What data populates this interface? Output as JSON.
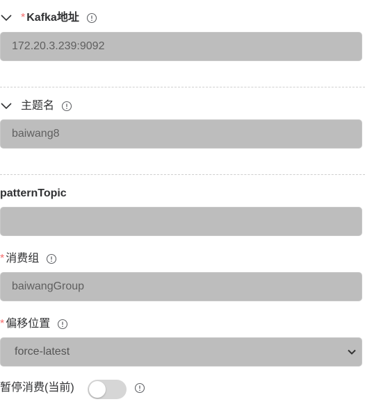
{
  "kafka_address": {
    "required_mark": "*",
    "label": "Kafka地址",
    "value": "172.20.3.239:9092",
    "collapse_icon": "chevron-down-icon",
    "info_icon": "info-circle-icon"
  },
  "topic_name": {
    "label": "主题名",
    "value": "baiwang8",
    "collapse_icon": "chevron-down-icon",
    "info_icon": "info-circle-icon"
  },
  "pattern_topic": {
    "label": "patternTopic",
    "value": ""
  },
  "consumer_group": {
    "required_mark": "*",
    "label": "消费组",
    "value": "baiwangGroup",
    "info_icon": "info-circle-icon"
  },
  "offset_position": {
    "required_mark": "*",
    "label": "偏移位置",
    "selected": "force-latest",
    "info_icon": "info-circle-icon"
  },
  "pause_consumption": {
    "label": "暂停消费(当前)",
    "enabled": false,
    "info_icon": "info-circle-icon"
  },
  "colors": {
    "required": "#f56c6c",
    "input_bg": "#bdbdbd",
    "toggle_off": "#d6d6d6"
  }
}
